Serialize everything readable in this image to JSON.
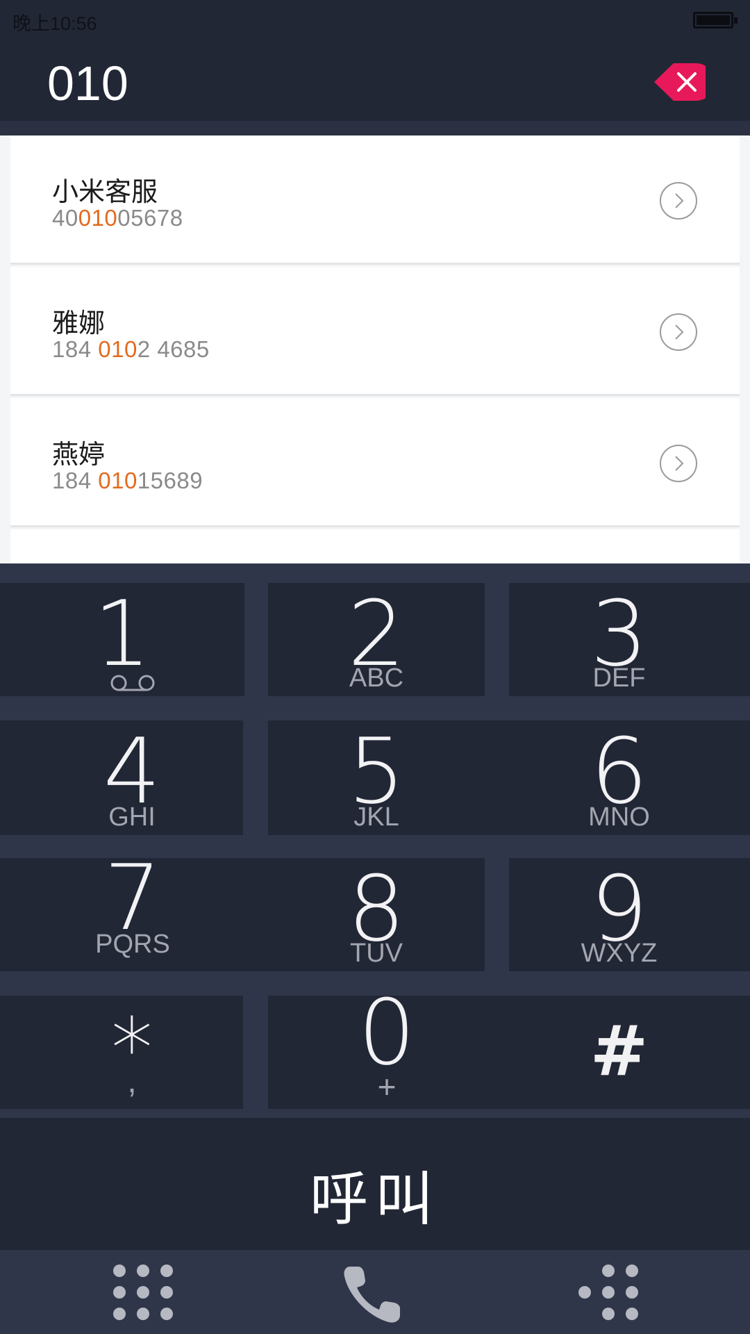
{
  "status_bar": {
    "time": "晚上10:56",
    "battery_icon": "battery-full-icon"
  },
  "header": {
    "dialed_number": "010",
    "delete_icon": "backspace-icon",
    "accent_color": "#e8195a"
  },
  "results": [
    {
      "name": "小米客服",
      "number_prefix": "40",
      "number_match": "010",
      "number_suffix": "05678"
    },
    {
      "name": "雅娜",
      "number_prefix": "184 ",
      "number_match": "010",
      "number_suffix": "2 4685"
    },
    {
      "name": "燕婷",
      "number_prefix": "184 ",
      "number_match": "010",
      "number_suffix": "15689"
    }
  ],
  "highlight_color": "#e36a1e",
  "keypad": {
    "keys": [
      {
        "digit": "1",
        "letters": "",
        "icon": "voicemail-icon"
      },
      {
        "digit": "2",
        "letters": "ABC"
      },
      {
        "digit": "3",
        "letters": "DEF"
      },
      {
        "digit": "4",
        "letters": "GHI"
      },
      {
        "digit": "5",
        "letters": "JKL"
      },
      {
        "digit": "6",
        "letters": "MNO"
      },
      {
        "digit": "7",
        "letters": "PQRS"
      },
      {
        "digit": "8",
        "letters": "TUV"
      },
      {
        "digit": "9",
        "letters": "WXYZ"
      },
      {
        "digit": "*",
        "letters": ","
      },
      {
        "digit": "0",
        "letters": "+"
      },
      {
        "digit": "#",
        "letters": ""
      }
    ]
  },
  "call_button": {
    "label": "呼叫"
  },
  "bottom_nav": {
    "left_icon": "keypad-icon",
    "center_icon": "phone-icon",
    "right_icon": "speed-dial-icon"
  }
}
